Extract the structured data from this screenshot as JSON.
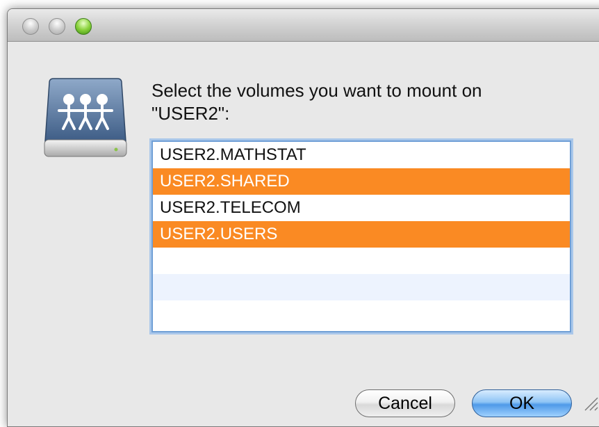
{
  "window": {
    "traffic_lights": [
      "close",
      "minimize",
      "zoom"
    ]
  },
  "dialog": {
    "icon": "network-drive-icon",
    "prompt": "Select the volumes you want to mount on \"USER2\":"
  },
  "volumes": [
    {
      "label": "USER2.MATHSTAT",
      "selected": false
    },
    {
      "label": "USER2.SHARED",
      "selected": true
    },
    {
      "label": "USER2.TELECOM",
      "selected": false
    },
    {
      "label": "USER2.USERS",
      "selected": true
    }
  ],
  "buttons": {
    "cancel": "Cancel",
    "ok": "OK"
  },
  "colors": {
    "selection": "#fa8a23",
    "focus_ring": "#6f9fd6",
    "default_button": "#4f9ae8",
    "zoom_button": "#8ad23c"
  }
}
